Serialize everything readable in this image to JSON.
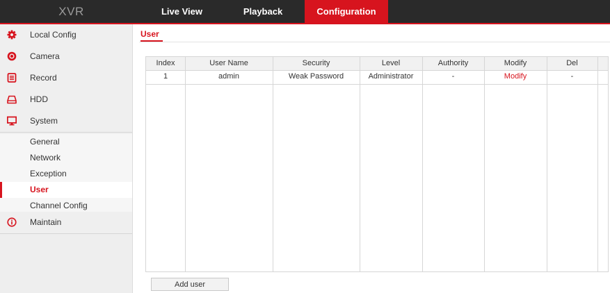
{
  "app": {
    "logo": "XVR"
  },
  "nav": {
    "tabs": [
      {
        "label": "Live View"
      },
      {
        "label": "Playback"
      },
      {
        "label": "Configuration",
        "active": true
      }
    ]
  },
  "sidebar": {
    "items": [
      {
        "label": "Local Config",
        "icon": "gear-icon"
      },
      {
        "label": "Camera",
        "icon": "camera-icon"
      },
      {
        "label": "Record",
        "icon": "record-icon"
      },
      {
        "label": "HDD",
        "icon": "hdd-icon"
      },
      {
        "label": "System",
        "icon": "monitor-icon"
      },
      {
        "label": "Maintain",
        "icon": "info-icon"
      }
    ],
    "system_sub": [
      {
        "label": "General"
      },
      {
        "label": "Network"
      },
      {
        "label": "Exception"
      },
      {
        "label": "User",
        "active": true
      },
      {
        "label": "Channel Config"
      }
    ]
  },
  "main": {
    "tab": "User",
    "table": {
      "columns": [
        "Index",
        "User Name",
        "Security",
        "Level",
        "Authority",
        "Modify",
        "Del"
      ],
      "rows": [
        [
          "1",
          "admin",
          "Weak Password",
          "Administrator",
          "-",
          "Modify",
          "-"
        ]
      ]
    },
    "add_user_label": "Add user"
  },
  "colors": {
    "accent": "#d7141e",
    "topbar": "#2a2a2a",
    "sidebar": "#eeeeee"
  }
}
